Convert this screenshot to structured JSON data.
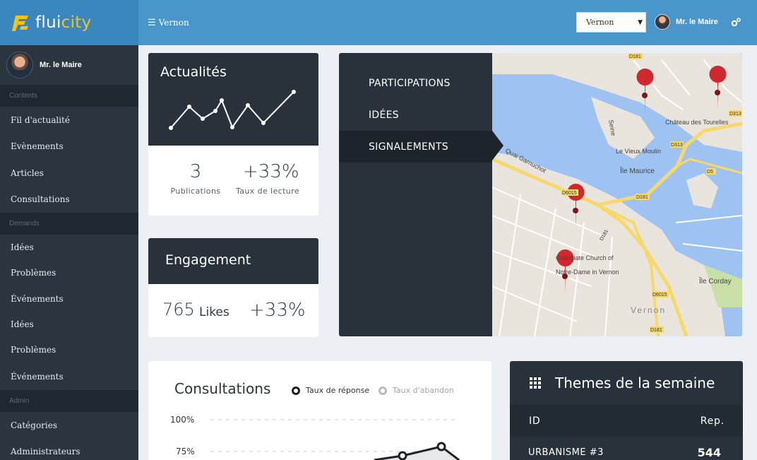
{
  "app": {
    "logo_prefix": "flui",
    "logo_suffix": "city",
    "menu_label": "Vernon",
    "city_select_value": "Vernon",
    "user_name": "Mr. le Maire",
    "colors": {
      "topbar": "#4a96cb",
      "logo_bg": "#3a87bf",
      "logo_accent": "#f4c21f",
      "sidebar": "#2b353f",
      "dark_card": "#29323a"
    }
  },
  "sidebar": {
    "user_name": "Mr. le Maire",
    "sections": [
      {
        "title": "Contents",
        "items": [
          "Fil d'actualité",
          "Evènements",
          "Articles",
          "Consultations"
        ]
      },
      {
        "title": "Demands",
        "items": [
          "Idées",
          "Problèmes",
          "Événements",
          "Idées",
          "Problèmes",
          "Événements"
        ]
      },
      {
        "title": "Admin",
        "items": [
          "Catégories",
          "Administrateurs"
        ]
      }
    ]
  },
  "actualites": {
    "title": "Actualités",
    "stats": [
      {
        "value": "3",
        "label": "Publications"
      },
      {
        "value": "+33%",
        "label": "Taux de lecture"
      }
    ]
  },
  "engagement": {
    "title": "Engagement",
    "likes_value": "765",
    "likes_label": "Likes",
    "growth": "+33%"
  },
  "map_panel": {
    "menu": [
      "PARTICIPATIONS",
      "IDÉES",
      "SIGNALEMENTS"
    ],
    "active_index": 2,
    "map_labels": [
      "Château des Tourelles",
      "Le Vieux Moulin",
      "Île Maurice",
      "Île Corday",
      "Collegiate Church of Notre-Dame in Vernon",
      "Vernon",
      "Quai Garnuchot",
      "Seine"
    ],
    "road_labels": [
      "D181",
      "D313",
      "D313",
      "D5",
      "D6015",
      "D181",
      "D181",
      "D6015",
      "D181"
    ]
  },
  "consultations": {
    "title": "Consultations",
    "legend": [
      "Taux de réponse",
      "Taux d'abandon"
    ],
    "y_ticks": [
      "100%",
      "75%"
    ]
  },
  "themes": {
    "title": "Themes de la semaine",
    "col_id": "ID",
    "col_rep": "Rep.",
    "rows": [
      {
        "name": "URBANISME #3",
        "value": "544"
      }
    ]
  }
}
